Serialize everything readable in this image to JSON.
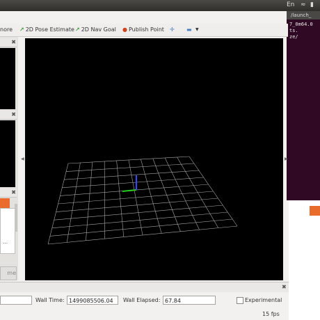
{
  "topbar": {
    "ime": "En",
    "icons": [
      "wifi-icon",
      "battery-icon",
      "volume-icon"
    ]
  },
  "terminal": {
    "title": "/launch_",
    "lines": [
      "7_0m64.0",
      "",
      "ts.",
      "",
      "",
      "",
      "",
      "ze/",
      ""
    ],
    "bg": "#300a24"
  },
  "toolbar": {
    "interact_partial": "nore",
    "pose_estimate": "2D Pose Estimate",
    "nav_goal": "2D Nav Goal",
    "publish_point": "Publish Point"
  },
  "bottom_partial": "me",
  "status": {
    "ros_time_value": "",
    "wall_time_label": "Wall Time:",
    "wall_time_value": "1499085506.04",
    "wall_elapsed_label": "Wall Elapsed:",
    "wall_elapsed_value": "67.84",
    "experimental_label": "Experimental",
    "fps": "15 fps"
  },
  "colors": {
    "viewport_bg": "#000000",
    "grid": "#a8a8a8",
    "x_axis": "#ff2020",
    "y_axis": "#22d022",
    "z_axis": "#2a4bff"
  }
}
